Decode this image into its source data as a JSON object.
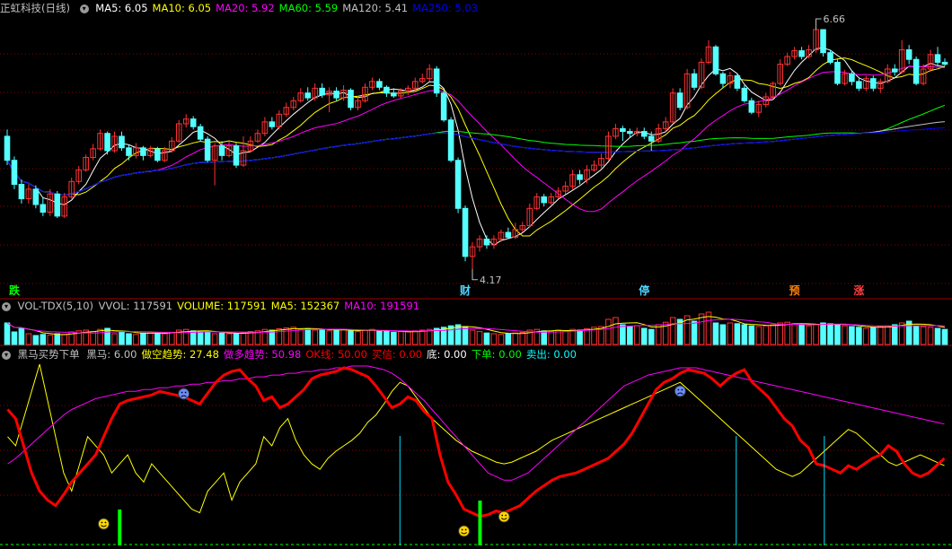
{
  "main": {
    "title": "正虹科技(日线)",
    "ma": [
      {
        "label": "MA5: 6.05",
        "color": "#ffffff"
      },
      {
        "label": "MA10: 6.05",
        "color": "#ffff00"
      },
      {
        "label": "MA20: 5.92",
        "color": "#ff00ff"
      },
      {
        "label": "MA60: 5.59",
        "color": "#00ff00"
      },
      {
        "label": "MA120: 5.41",
        "color": "#c0c0c0"
      },
      {
        "label": "MA250: 5.03",
        "color": "#0000ff"
      }
    ],
    "high_label": "6.66",
    "low_label": "4.17",
    "markers": [
      {
        "text": "跌",
        "color": "#00ff00",
        "bar": 1
      },
      {
        "text": "财",
        "color": "#4fd6ff",
        "bar": 64
      },
      {
        "text": "停",
        "color": "#4fd6ff",
        "bar": 89
      },
      {
        "text": "预",
        "color": "#ff8000",
        "bar": 110
      },
      {
        "text": "涨",
        "color": "#ff4040",
        "bar": 119
      }
    ]
  },
  "volume": {
    "title": "VOL-TDX(5,10)",
    "stats": [
      {
        "label": "VVOL: 117591",
        "color": "#c0c0c0"
      },
      {
        "label": "VOLUME: 117591",
        "color": "#ffff00"
      },
      {
        "label": "MA5: 152367",
        "color": "#ffff00"
      },
      {
        "label": "MA10: 191591",
        "color": "#ff00ff"
      }
    ]
  },
  "indicator": {
    "title": "黑马买势下单",
    "stats": [
      {
        "label": "黑马: 6.00",
        "color": "#c0c0c0"
      },
      {
        "label": "做空趋势: 27.48",
        "color": "#ffff00"
      },
      {
        "label": "做多趋势: 50.98",
        "color": "#ff00ff"
      },
      {
        "label": "OK线: 50.00",
        "color": "#ff0000"
      },
      {
        "label": "买信: 0.00",
        "color": "#ff0000"
      },
      {
        "label": "底: 0.00",
        "color": "#ffffff"
      },
      {
        "label": "下单: 0.00",
        "color": "#00ff00"
      },
      {
        "label": "卖出: 0.00",
        "color": "#00ffff"
      }
    ]
  },
  "colors": {
    "up": "#ff3232",
    "down": "#54ffff",
    "grid": "#8b0000",
    "bg": "#000000"
  },
  "chart_data": {
    "type": "candlestick",
    "price_range": [
      4.0,
      6.8
    ],
    "candles": [
      [
        5.55,
        5.3,
        5.62,
        5.25
      ],
      [
        5.3,
        5.05,
        5.34,
        5.0
      ],
      [
        5.05,
        4.9,
        5.1,
        4.85
      ],
      [
        4.9,
        5.0,
        5.05,
        4.85
      ],
      [
        5.0,
        4.84,
        5.04,
        4.8
      ],
      [
        4.84,
        4.76,
        4.92,
        4.72
      ],
      [
        4.76,
        4.95,
        5.0,
        4.72
      ],
      [
        4.95,
        4.72,
        4.98,
        4.7
      ],
      [
        4.72,
        4.92,
        4.96,
        4.7
      ],
      [
        4.92,
        5.08,
        5.12,
        4.9
      ],
      [
        5.08,
        5.2,
        5.24,
        5.05
      ],
      [
        5.2,
        5.33,
        5.36,
        5.18
      ],
      [
        5.33,
        5.42,
        5.47,
        5.3
      ],
      [
        5.42,
        5.58,
        5.62,
        5.4
      ],
      [
        5.58,
        5.4,
        5.6,
        5.36
      ],
      [
        5.4,
        5.55,
        5.6,
        5.38
      ],
      [
        5.55,
        5.43,
        5.6,
        5.4
      ],
      [
        5.43,
        5.35,
        5.46,
        5.3
      ],
      [
        5.35,
        5.43,
        5.48,
        5.32
      ],
      [
        5.43,
        5.35,
        5.45,
        5.3
      ],
      [
        5.35,
        5.42,
        5.45,
        5.33
      ],
      [
        5.42,
        5.3,
        5.44,
        5.28
      ],
      [
        5.3,
        5.4,
        5.44,
        5.28
      ],
      [
        5.4,
        5.5,
        5.54,
        5.38
      ],
      [
        5.5,
        5.68,
        5.72,
        5.48
      ],
      [
        5.68,
        5.73,
        5.78,
        5.64
      ],
      [
        5.73,
        5.65,
        5.76,
        5.62
      ],
      [
        5.65,
        5.52,
        5.68,
        5.5
      ],
      [
        5.52,
        5.3,
        5.55,
        5.28
      ],
      [
        5.3,
        5.45,
        5.48,
        5.04
      ],
      [
        5.45,
        5.35,
        5.5,
        5.3
      ],
      [
        5.35,
        5.45,
        5.5,
        5.33
      ],
      [
        5.45,
        5.25,
        5.48,
        5.22
      ],
      [
        5.25,
        5.4,
        5.55,
        5.23
      ],
      [
        5.4,
        5.5,
        5.55,
        5.38
      ],
      [
        5.5,
        5.58,
        5.62,
        5.48
      ],
      [
        5.58,
        5.7,
        5.75,
        5.55
      ],
      [
        5.7,
        5.65,
        5.75,
        5.62
      ],
      [
        5.65,
        5.78,
        5.82,
        5.62
      ],
      [
        5.78,
        5.85,
        5.9,
        5.75
      ],
      [
        5.85,
        5.92,
        5.96,
        5.82
      ],
      [
        5.92,
        6.0,
        6.05,
        5.9
      ],
      [
        6.0,
        5.95,
        6.06,
        5.92
      ],
      [
        5.95,
        6.05,
        6.1,
        5.92
      ],
      [
        6.05,
        5.98,
        6.1,
        5.95
      ],
      [
        5.98,
        6.02,
        6.06,
        5.8
      ],
      [
        6.02,
        5.95,
        6.06,
        5.92
      ],
      [
        5.95,
        6.03,
        6.08,
        5.92
      ],
      [
        6.03,
        5.85,
        6.05,
        5.82
      ],
      [
        5.85,
        5.92,
        5.96,
        5.82
      ],
      [
        5.92,
        6.06,
        6.1,
        5.9
      ],
      [
        6.06,
        6.12,
        6.16,
        6.03
      ],
      [
        6.12,
        6.06,
        6.15,
        6.03
      ],
      [
        6.06,
        6.0,
        6.08,
        5.96
      ],
      [
        6.0,
        5.97,
        6.05,
        5.95
      ],
      [
        5.97,
        6.02,
        6.05,
        5.94
      ],
      [
        6.02,
        6.05,
        6.08,
        5.98
      ],
      [
        6.05,
        6.12,
        6.16,
        6.02
      ],
      [
        6.12,
        6.15,
        6.2,
        6.1
      ],
      [
        6.15,
        6.25,
        6.3,
        6.12
      ],
      [
        6.25,
        6.0,
        6.28,
        5.96
      ],
      [
        6.0,
        5.72,
        6.03,
        5.7
      ],
      [
        5.72,
        5.3,
        5.75,
        5.28
      ],
      [
        5.3,
        4.8,
        5.33,
        4.75
      ],
      [
        4.8,
        4.3,
        4.83,
        4.25
      ],
      [
        4.3,
        4.4,
        4.45,
        4.17
      ],
      [
        4.4,
        4.48,
        4.52,
        4.35
      ],
      [
        4.48,
        4.42,
        4.52,
        4.38
      ],
      [
        4.42,
        4.48,
        4.52,
        4.38
      ],
      [
        4.48,
        4.55,
        4.58,
        4.45
      ],
      [
        4.55,
        4.5,
        4.6,
        4.48
      ],
      [
        4.5,
        4.58,
        4.65,
        4.48
      ],
      [
        4.58,
        4.62,
        4.66,
        4.55
      ],
      [
        4.62,
        4.8,
        4.85,
        4.6
      ],
      [
        4.8,
        4.92,
        4.96,
        4.78
      ],
      [
        4.92,
        4.86,
        4.95,
        4.82
      ],
      [
        4.86,
        4.92,
        4.96,
        4.84
      ],
      [
        4.92,
        4.98,
        5.02,
        4.9
      ],
      [
        4.98,
        5.03,
        5.08,
        4.95
      ],
      [
        5.03,
        5.15,
        5.2,
        5.0
      ],
      [
        5.15,
        5.1,
        5.2,
        5.05
      ],
      [
        5.1,
        5.2,
        5.25,
        5.06
      ],
      [
        5.2,
        5.25,
        5.3,
        5.18
      ],
      [
        5.25,
        5.32,
        5.37,
        5.22
      ],
      [
        5.32,
        5.55,
        5.6,
        5.3
      ],
      [
        5.55,
        5.63,
        5.68,
        5.52
      ],
      [
        5.63,
        5.6,
        5.66,
        5.5
      ],
      [
        5.6,
        5.58,
        5.63,
        5.54
      ],
      [
        5.58,
        5.6,
        5.64,
        5.55
      ],
      [
        5.6,
        5.55,
        5.64,
        5.52
      ],
      [
        5.55,
        5.5,
        5.6,
        5.4
      ],
      [
        5.5,
        5.63,
        5.68,
        5.48
      ],
      [
        5.63,
        5.7,
        5.75,
        5.6
      ],
      [
        5.7,
        6.0,
        6.05,
        5.68
      ],
      [
        6.0,
        5.85,
        6.05,
        5.82
      ],
      [
        5.85,
        6.2,
        6.25,
        5.83
      ],
      [
        6.2,
        6.06,
        6.25,
        6.03
      ],
      [
        6.06,
        6.32,
        6.36,
        6.04
      ],
      [
        6.32,
        6.48,
        6.55,
        6.3
      ],
      [
        6.48,
        6.2,
        6.5,
        6.18
      ],
      [
        6.2,
        6.1,
        6.22,
        6.05
      ],
      [
        6.1,
        6.18,
        6.22,
        6.05
      ],
      [
        6.18,
        6.05,
        6.2,
        6.02
      ],
      [
        6.05,
        5.92,
        6.08,
        5.9
      ],
      [
        5.92,
        5.8,
        5.95,
        5.78
      ],
      [
        5.8,
        5.88,
        5.92,
        5.75
      ],
      [
        5.88,
        5.96,
        6.0,
        5.85
      ],
      [
        5.96,
        6.1,
        6.12,
        5.94
      ],
      [
        6.1,
        6.3,
        6.35,
        6.08
      ],
      [
        6.3,
        6.38,
        6.42,
        6.28
      ],
      [
        6.38,
        6.44,
        6.48,
        6.35
      ],
      [
        6.44,
        6.38,
        6.48,
        6.35
      ],
      [
        6.38,
        6.45,
        6.5,
        6.36
      ],
      [
        6.45,
        6.66,
        6.66,
        6.42
      ],
      [
        6.66,
        6.42,
        6.66,
        6.38
      ],
      [
        6.42,
        6.32,
        6.45,
        6.3
      ],
      [
        6.32,
        6.1,
        6.35,
        6.08
      ],
      [
        6.1,
        6.2,
        6.24,
        6.08
      ],
      [
        6.2,
        6.12,
        6.24,
        6.08
      ],
      [
        6.12,
        6.05,
        6.15,
        6.02
      ],
      [
        6.05,
        6.15,
        6.18,
        6.02
      ],
      [
        6.15,
        6.05,
        6.18,
        6.02
      ],
      [
        6.05,
        6.12,
        6.15,
        6.0
      ],
      [
        6.12,
        6.25,
        6.3,
        6.1
      ],
      [
        6.25,
        6.22,
        6.3,
        6.18
      ],
      [
        6.22,
        6.45,
        6.55,
        6.2
      ],
      [
        6.45,
        6.35,
        6.5,
        6.3
      ],
      [
        6.35,
        6.1,
        6.38,
        6.08
      ],
      [
        6.1,
        6.25,
        6.3,
        6.08
      ],
      [
        6.25,
        6.4,
        6.45,
        6.22
      ],
      [
        6.4,
        6.32,
        6.48,
        6.28
      ],
      [
        6.32,
        6.3,
        6.36,
        6.28
      ]
    ],
    "volume": [
      60,
      35,
      45,
      30,
      25,
      28,
      26,
      30,
      28,
      35,
      38,
      40,
      36,
      42,
      45,
      30,
      35,
      30,
      28,
      32,
      35,
      32,
      30,
      34,
      40,
      42,
      38,
      35,
      36,
      30,
      32,
      30,
      30,
      34,
      36,
      38,
      42,
      40,
      44,
      46,
      48,
      42,
      44,
      40,
      42,
      38,
      40,
      42,
      38,
      36,
      40,
      42,
      38,
      36,
      34,
      36,
      35,
      38,
      40,
      42,
      45,
      48,
      52,
      55,
      50,
      40,
      36,
      32,
      30,
      28,
      30,
      32,
      34,
      40,
      42,
      38,
      36,
      40,
      38,
      42,
      40,
      44,
      48,
      50,
      70,
      75,
      55,
      50,
      52,
      45,
      42,
      55,
      62,
      75,
      70,
      80,
      65,
      85,
      90,
      60,
      55,
      60,
      58,
      55,
      52,
      50,
      52,
      55,
      60,
      62,
      58,
      55,
      52,
      55,
      60,
      58,
      55,
      52,
      50,
      48,
      45,
      48,
      50,
      52,
      55,
      60,
      65,
      52,
      50,
      48,
      45,
      42
    ],
    "horse_line": [
      75,
      70,
      55,
      40,
      30,
      25,
      22,
      28,
      35,
      40,
      45,
      50,
      60,
      70,
      78,
      80,
      81,
      82,
      83,
      85,
      84,
      83,
      82,
      80,
      78,
      84,
      90,
      94,
      96,
      97,
      92,
      88,
      80,
      82,
      76,
      78,
      82,
      86,
      92,
      94,
      95,
      96,
      98,
      97,
      95,
      93,
      88,
      82,
      76,
      78,
      82,
      80,
      74,
      70,
      50,
      35,
      28,
      20,
      18,
      16,
      17,
      19,
      18,
      20,
      22,
      26,
      30,
      33,
      36,
      38,
      39,
      40,
      42,
      44,
      46,
      48,
      52,
      56,
      62,
      70,
      78,
      86,
      90,
      92,
      95,
      97,
      96,
      95,
      92,
      88,
      92,
      95,
      97,
      90,
      86,
      82,
      76,
      70,
      66,
      58,
      54,
      45,
      44,
      42,
      40,
      44,
      42,
      45,
      48,
      50,
      55,
      52,
      45,
      40,
      38,
      40,
      44,
      48
    ],
    "short_trend": [
      60,
      55,
      70,
      85,
      100,
      80,
      60,
      40,
      30,
      45,
      60,
      55,
      50,
      40,
      45,
      50,
      40,
      35,
      45,
      40,
      35,
      30,
      25,
      20,
      18,
      30,
      35,
      40,
      25,
      35,
      40,
      45,
      60,
      55,
      65,
      70,
      58,
      50,
      45,
      42,
      48,
      52,
      55,
      58,
      62,
      68,
      72,
      78,
      85,
      90,
      88,
      82,
      76,
      70,
      66,
      62,
      58,
      55,
      52,
      50,
      48,
      46,
      45,
      46,
      48,
      50,
      52,
      55,
      58,
      60,
      62,
      64,
      66,
      68,
      70,
      72,
      74,
      76,
      78,
      80,
      82,
      84,
      86,
      88,
      90,
      86,
      82,
      78,
      74,
      70,
      66,
      62,
      58,
      54,
      50,
      46,
      42,
      40,
      38,
      40,
      44,
      48,
      52,
      56,
      60,
      64,
      62,
      58,
      54,
      50,
      46,
      44,
      46,
      48,
      50,
      48,
      46,
      44
    ],
    "long_trend": [
      45,
      48,
      52,
      56,
      60,
      64,
      68,
      72,
      75,
      77,
      79,
      81,
      82,
      83,
      84,
      85,
      85,
      86,
      86,
      87,
      87,
      88,
      88,
      89,
      89,
      90,
      90,
      91,
      91,
      92,
      92,
      93,
      93,
      94,
      94,
      95,
      95,
      96,
      96,
      97,
      97,
      98,
      98,
      99,
      99,
      99,
      98,
      97,
      95,
      92,
      88,
      84,
      80,
      75,
      70,
      65,
      60,
      55,
      50,
      45,
      40,
      38,
      36,
      36,
      38,
      40,
      44,
      48,
      52,
      56,
      60,
      64,
      68,
      72,
      76,
      80,
      84,
      88,
      90,
      92,
      94,
      95,
      96,
      97,
      98,
      98,
      98,
      97,
      96,
      95,
      94,
      93,
      92,
      91,
      90,
      89,
      88,
      87,
      86,
      85,
      84,
      83,
      82,
      81,
      80,
      79,
      78,
      77,
      76,
      75,
      74,
      73,
      72,
      71,
      70,
      69,
      68,
      67
    ]
  }
}
